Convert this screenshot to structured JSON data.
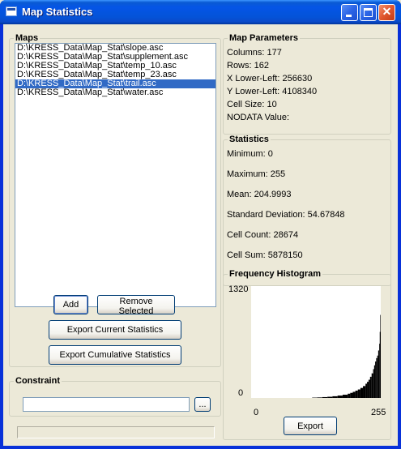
{
  "window": {
    "title": "Map Statistics",
    "icon": "app-window-icon"
  },
  "maps": {
    "legend": "Maps",
    "items": [
      {
        "label": "D:\\KRESS_Data\\Map_Stat\\slope.asc",
        "selected": false
      },
      {
        "label": "D:\\KRESS_Data\\Map_Stat\\supplement.asc",
        "selected": false
      },
      {
        "label": "D:\\KRESS_Data\\Map_Stat\\temp_10.asc",
        "selected": false
      },
      {
        "label": "D:\\KRESS_Data\\Map_Stat\\temp_23.asc",
        "selected": false
      },
      {
        "label": "D:\\KRESS_Data\\Map_Stat\\trail.asc",
        "selected": true
      },
      {
        "label": "D:\\KRESS_Data\\Map_Stat\\water.asc",
        "selected": false
      }
    ],
    "add_label": "Add",
    "remove_label": "Remove Selected",
    "export_current_label": "Export Current Statistics",
    "export_cumulative_label": "Export Cumulative Statistics"
  },
  "constraint": {
    "legend": "Constraint",
    "value": "",
    "browse_label": "..."
  },
  "parameters": {
    "legend": "Map Parameters",
    "columns": "Columns: 177",
    "rows": "Rows: 162",
    "x_lower_left": "X Lower-Left: 256630",
    "y_lower_left": "Y Lower-Left: 4108340",
    "cell_size": "Cell Size: 10",
    "nodata": "NODATA Value:"
  },
  "statistics": {
    "legend": "Statistics",
    "minimum": "Minimum: 0",
    "maximum": "Maximum: 255",
    "mean": "Mean: 204.9993",
    "std_dev": "Standard Deviation: 54.67848",
    "cell_count": "Cell Count: 28674",
    "cell_sum": "Cell Sum: 5878150"
  },
  "histogram": {
    "legend": "Frequency Histogram",
    "export_label": "Export"
  },
  "chart_data": {
    "type": "bar",
    "title": "Frequency Histogram",
    "y_max_label": "1320",
    "y_min_label": "0",
    "x_min_label": "0",
    "x_max_label": "255",
    "xlim": [
      0,
      255
    ],
    "ylim": [
      0,
      1320
    ],
    "x": [
      120,
      130,
      140,
      150,
      160,
      170,
      180,
      190,
      195,
      200,
      205,
      210,
      215,
      220,
      225,
      228,
      231,
      234,
      237,
      240,
      242,
      244,
      246,
      248,
      250,
      252,
      253,
      254,
      255
    ],
    "values": [
      4,
      6,
      10,
      14,
      20,
      28,
      38,
      50,
      60,
      72,
      86,
      100,
      118,
      140,
      168,
      190,
      215,
      250,
      290,
      340,
      385,
      430,
      470,
      500,
      560,
      640,
      780,
      980,
      1320
    ]
  },
  "colors": {
    "selection": "#316ac5",
    "titlebar": "#0555e6",
    "face": "#ece9d8"
  }
}
